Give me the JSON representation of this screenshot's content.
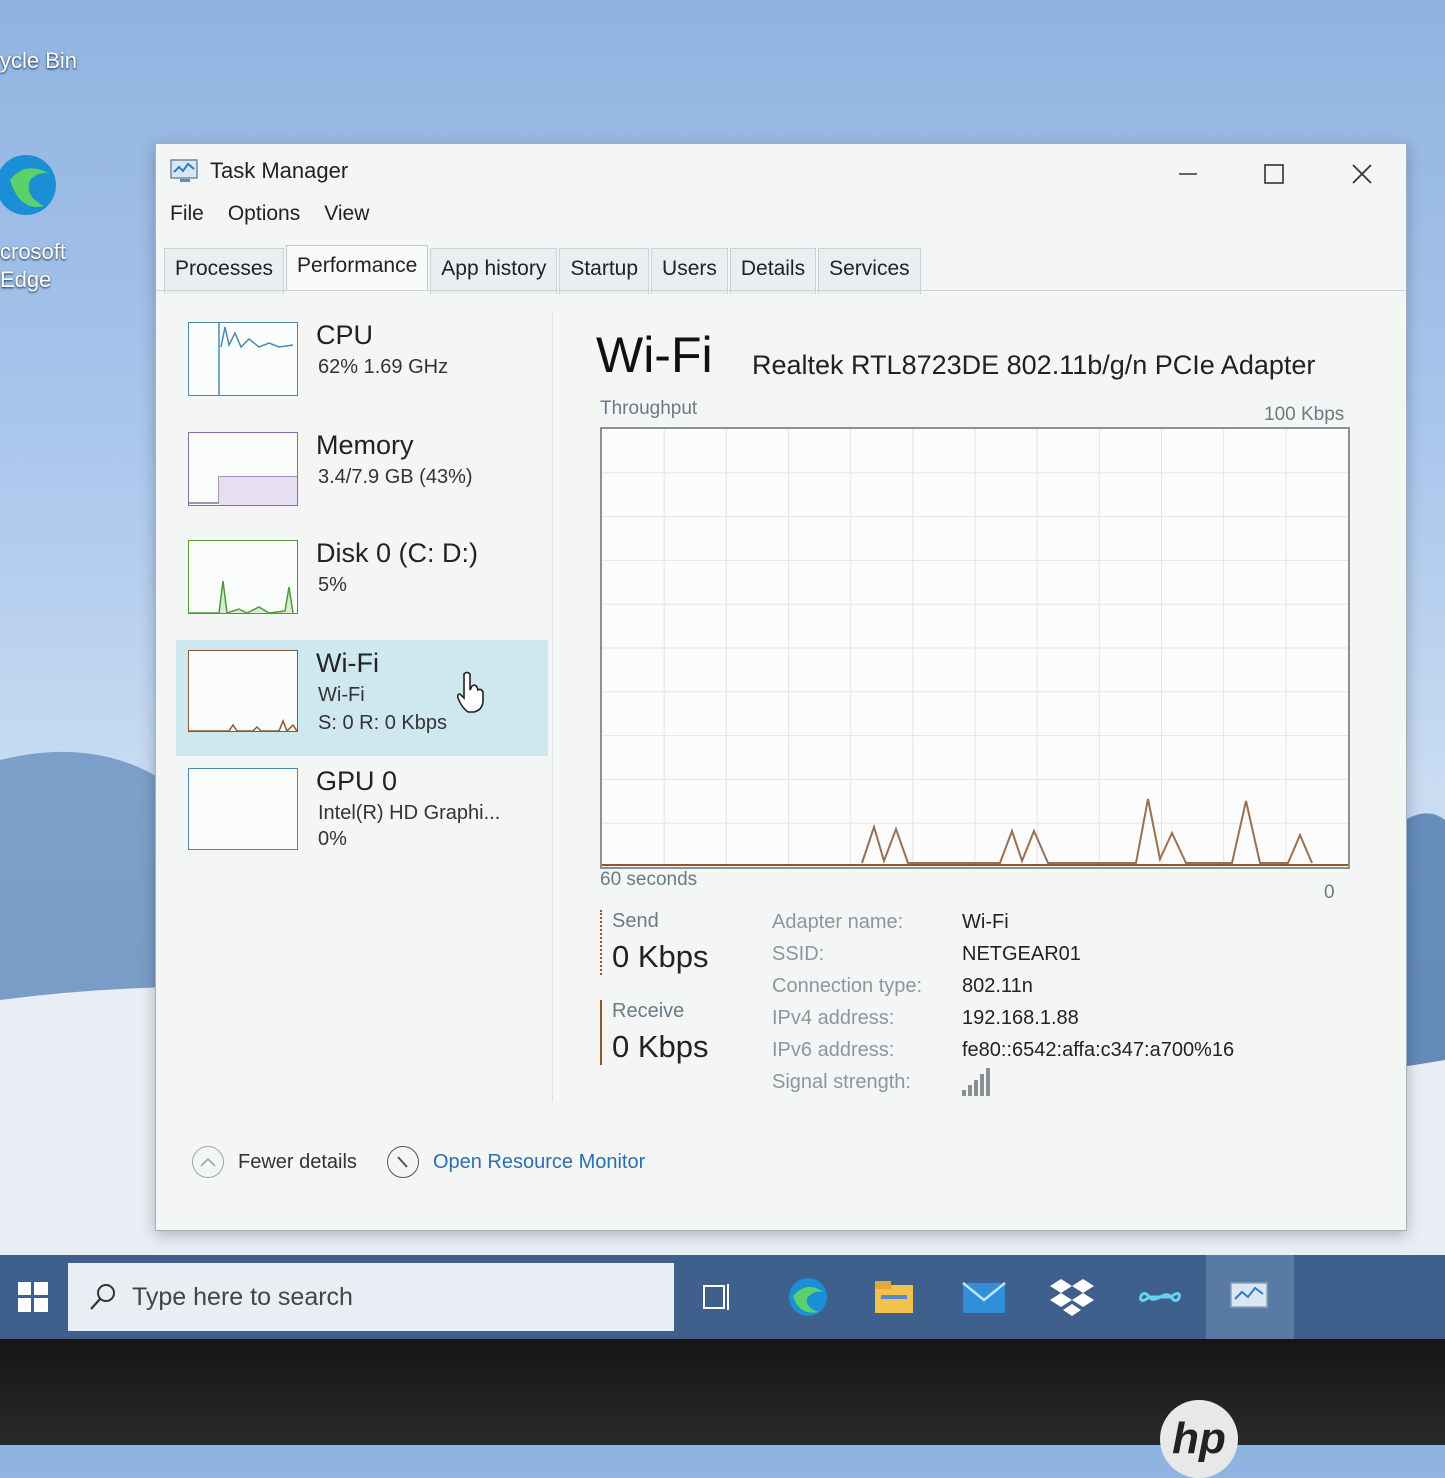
{
  "desktop": {
    "recycle_label": "ycle Bin",
    "edge_label_1": "crosoft",
    "edge_label_2": "Edge"
  },
  "window": {
    "title": "Task Manager",
    "menu": [
      "File",
      "Options",
      "View"
    ],
    "tabs": [
      "Processes",
      "Performance",
      "App history",
      "Startup",
      "Users",
      "Details",
      "Services"
    ],
    "active_tab": "Performance"
  },
  "sidebar": {
    "cpu": {
      "name": "CPU",
      "sub": "62% 1.69 GHz"
    },
    "memory": {
      "name": "Memory",
      "sub": "3.4/7.9 GB (43%)"
    },
    "disk": {
      "name": "Disk 0 (C: D:)",
      "sub": "5%"
    },
    "wifi": {
      "name": "Wi-Fi",
      "sub1": "Wi-Fi",
      "sub2": "S: 0 R: 0 Kbps"
    },
    "gpu": {
      "name": "GPU 0",
      "sub1": "Intel(R) HD Graphi...",
      "sub2": "0%"
    }
  },
  "detail": {
    "title": "Wi-Fi",
    "adapter": "Realtek RTL8723DE 802.11b/g/n PCIe Adapter",
    "graph_label": "Throughput",
    "graph_max": "100 Kbps",
    "graph_time": "60 seconds",
    "graph_min": "0",
    "send_label": "Send",
    "send_value": "0 Kbps",
    "receive_label": "Receive",
    "receive_value": "0 Kbps",
    "props": [
      {
        "k": "Adapter name:",
        "v": "Wi-Fi"
      },
      {
        "k": "SSID:",
        "v": "NETGEAR01"
      },
      {
        "k": "Connection type:",
        "v": "802.11n"
      },
      {
        "k": "IPv4 address:",
        "v": "192.168.1.88"
      },
      {
        "k": "IPv6 address:",
        "v": "fe80::6542:affa:c347:a700%16"
      },
      {
        "k": "Signal strength:",
        "v": ""
      }
    ]
  },
  "chart_data": {
    "type": "line",
    "ylim": [
      0,
      100
    ],
    "x": [
      0,
      6,
      12,
      18,
      24,
      30,
      36,
      42,
      48,
      54,
      60
    ],
    "values": [
      0,
      0,
      0,
      0,
      0,
      0,
      0,
      0,
      0,
      0,
      0
    ]
  },
  "footer": {
    "fewer": "Fewer details",
    "monitor": "Open Resource Monitor"
  },
  "taskbar": {
    "search_placeholder": "Type here to search"
  },
  "brand": "hp",
  "colors": {
    "accent": "#4a8ab0",
    "selected": "#cfe7ef",
    "disk_green": "#4e9a3a",
    "wifi_brown": "#8b5a2b"
  }
}
